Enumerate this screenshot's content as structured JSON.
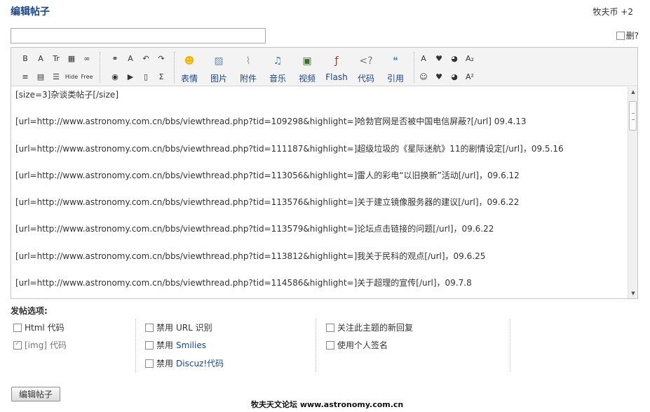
{
  "header": {
    "title": "编辑帖子",
    "credits": "牧夫币 +2"
  },
  "subject": {
    "value": ""
  },
  "delete_label": "删?",
  "toolbar": {
    "small_row1": [
      {
        "glyph": "B",
        "icon": "bold-icon"
      },
      {
        "glyph": "A",
        "icon": "font-face-icon"
      },
      {
        "glyph": "Tr",
        "icon": "font-size-icon"
      },
      {
        "glyph": "▦",
        "icon": "color-grid-icon"
      },
      {
        "glyph": "∞",
        "icon": "link-icon"
      },
      {
        "glyph": "⚭",
        "icon": "unlink-icon"
      },
      {
        "glyph": "A",
        "icon": "remove-format-icon"
      },
      {
        "glyph": "↶",
        "icon": "undo-icon"
      },
      {
        "glyph": "↷",
        "icon": "redo-icon"
      }
    ],
    "small_row2": [
      {
        "glyph": "≡",
        "icon": "align-icon"
      },
      {
        "glyph": "▤",
        "icon": "table-icon"
      },
      {
        "glyph": "☰",
        "icon": "list-icon"
      },
      {
        "glyph": "Hide",
        "icon": "hide-icon"
      },
      {
        "glyph": "Free",
        "icon": "free-icon"
      },
      {
        "glyph": "◉",
        "icon": "insert-image-icon"
      },
      {
        "glyph": "▶",
        "icon": "insert-media-icon"
      },
      {
        "glyph": "▯",
        "icon": "page-icon"
      },
      {
        "glyph": "Σ",
        "icon": "sum-icon"
      }
    ],
    "big_buttons": [
      {
        "label": "表情",
        "icon": "smiley-icon",
        "glyph": "☻",
        "color": "#f5b400"
      },
      {
        "label": "图片",
        "icon": "picture-icon",
        "glyph": "▨",
        "color": "#6b8fb3"
      },
      {
        "label": "附件",
        "icon": "attachment-icon",
        "glyph": "⌇",
        "color": "#9a9a9a"
      },
      {
        "label": "音乐",
        "icon": "music-icon",
        "glyph": "♫",
        "color": "#2f7fd1"
      },
      {
        "label": "视频",
        "icon": "video-icon",
        "glyph": "▣",
        "color": "#3b6d2f"
      },
      {
        "label": "Flash",
        "icon": "flash-icon",
        "glyph": "ƒ",
        "color": "#d2261c"
      },
      {
        "label": "代码",
        "icon": "code-icon",
        "glyph": "<?",
        "color": "#777777"
      },
      {
        "label": "引用",
        "icon": "quote-icon",
        "glyph": "❝",
        "color": "#4a90d9"
      }
    ],
    "right_row1": [
      {
        "glyph": "A",
        "icon": "font-style-icon"
      },
      {
        "glyph": "♥",
        "icon": "rm-icon"
      },
      {
        "glyph": "◕",
        "icon": "media-player-icon"
      },
      {
        "glyph": "A₂",
        "icon": "subscript-icon"
      }
    ],
    "right_row2": [
      {
        "glyph": "☺",
        "icon": "qq-icon"
      },
      {
        "glyph": "♥",
        "icon": "rm2-icon"
      },
      {
        "glyph": "◕",
        "icon": "media-player2-icon"
      },
      {
        "glyph": "A²",
        "icon": "superscript-icon"
      }
    ]
  },
  "editor": {
    "lines": [
      "[size=3]杂谈类帖子[/size]",
      "[url=http://www.astronomy.com.cn/bbs/viewthread.php?tid=109298&highlight=]哈勃官网是否被中国电信屏蔽?[/url] 09.4.13",
      "[url=http://www.astronomy.com.cn/bbs/viewthread.php?tid=111187&highlight=]超级垃圾的《星际迷航》11的剧情设定[/url]，09.5.16",
      "[url=http://www.astronomy.com.cn/bbs/viewthread.php?tid=113056&highlight=]雷人的彩电“以旧换新”活动[/url]，09.6.12",
      "[url=http://www.astronomy.com.cn/bbs/viewthread.php?tid=113576&highlight=]关于建立镜像服务器的建议[/url]，09.6.22",
      "[url=http://www.astronomy.com.cn/bbs/viewthread.php?tid=113579&highlight=]论坛点击链接的问题[/url]，09.6.22",
      "[url=http://www.astronomy.com.cn/bbs/viewthread.php?tid=113812&highlight=]我关于民科的观点[/url]，09.6.25",
      "[url=http://www.astronomy.com.cn/bbs/viewthread.php?tid=114586&highlight=]关于超理的宣传[/url]，09.7.8"
    ]
  },
  "options": {
    "title": "发帖选项:",
    "html_code": "Html 代码",
    "img_code": "[img] 代码",
    "disable": "禁用",
    "url_detect": "URL 识别",
    "smilies": "Smilies",
    "discuz_code": "Discuz!代码",
    "follow_replies": "关注此主题的新回复",
    "use_signature": "使用个人签名"
  },
  "submit_label": "编辑帖子",
  "watermark": "牧夫天文论坛 www.astronomy.com.cn"
}
